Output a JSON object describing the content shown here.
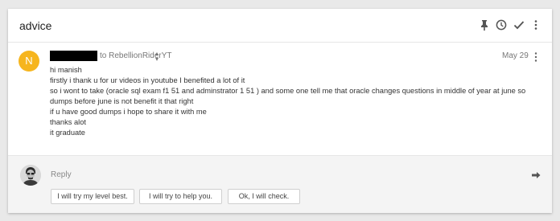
{
  "thread": {
    "subject": "advice"
  },
  "header_icons": [
    "pin-icon",
    "snooze-clock-icon",
    "done-check-icon",
    "more-vert-icon"
  ],
  "message": {
    "avatar_letter": "N",
    "avatar_color": "#f6b51e",
    "to_text": "to RebellionRiderYT",
    "date": "May 29",
    "body_lines": [
      "hi manish",
      "firstly i thank u for ur videos in youtube  I benefited a lot of it",
      "so i wont to take (oracle sql exam f1 51 and adminstrator 1  51 ) and some one tell me that oracle changes questions in middle of year at june so",
      "dumps before june is not benefit it that right",
      "if u have good dumps i hope to share it with me",
      "thanks alot",
      "it  graduate"
    ]
  },
  "reply": {
    "label": "Reply",
    "smart_replies": [
      "I will try my level best.",
      "I will try to help you.",
      "Ok, I will check."
    ]
  }
}
